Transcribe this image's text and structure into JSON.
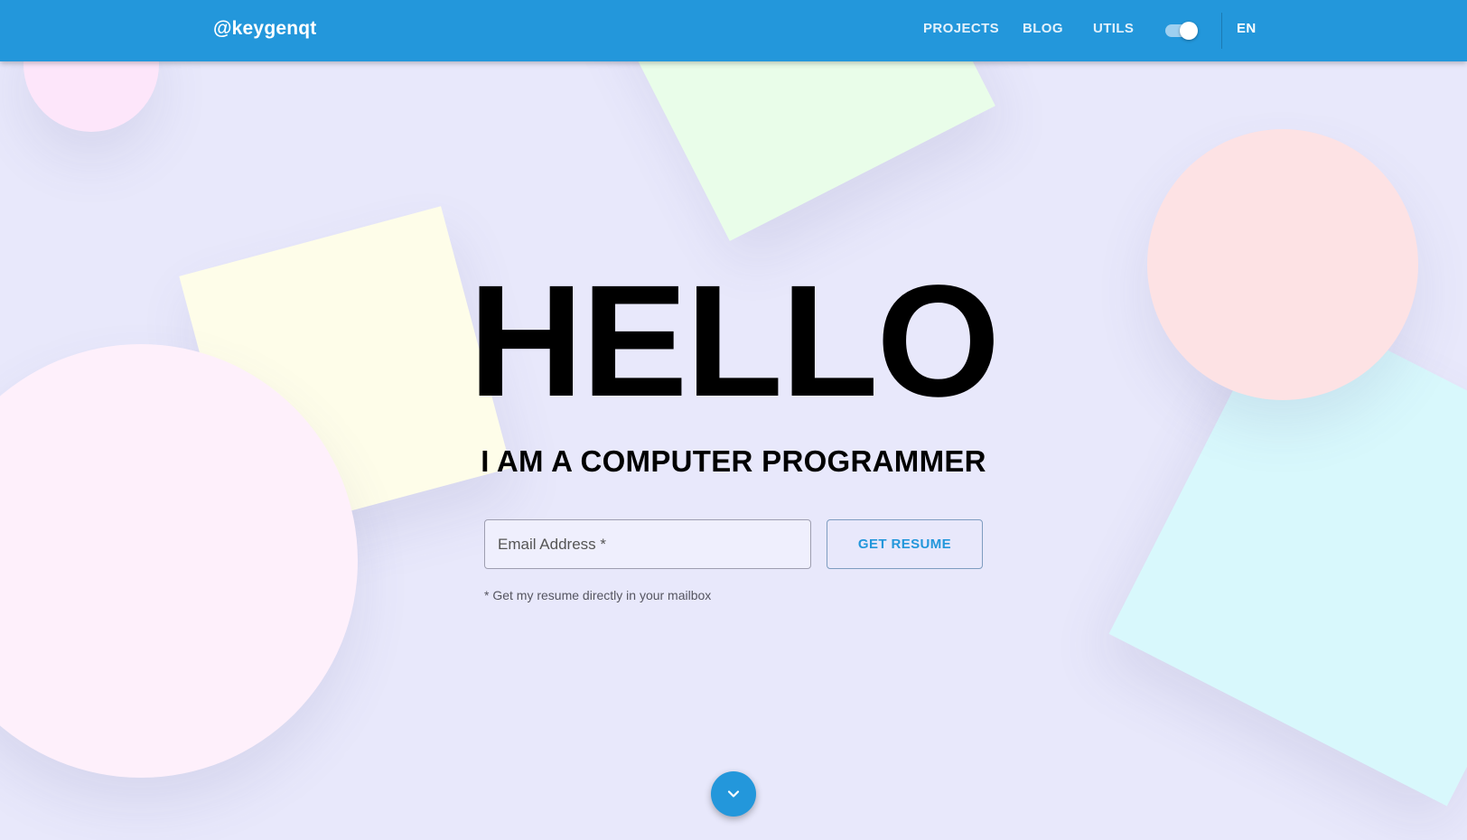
{
  "header": {
    "brand": "@keygenqt",
    "nav": {
      "projects": "PROJECTS",
      "blog": "BLOG",
      "utils": "UTILS"
    },
    "theme_toggle_on": true,
    "language": "EN"
  },
  "hero": {
    "title": "HELLO",
    "subtitle": "I AM A COMPUTER PROGRAMMER",
    "email_placeholder": "Email Address *",
    "resume_button": "GET RESUME",
    "helper_text": "* Get my resume directly in your mailbox"
  },
  "icons": {
    "scroll_down": "chevron-down-icon"
  },
  "colors": {
    "primary": "#2397db",
    "background": "#e8e8fb",
    "text": "#000000"
  }
}
